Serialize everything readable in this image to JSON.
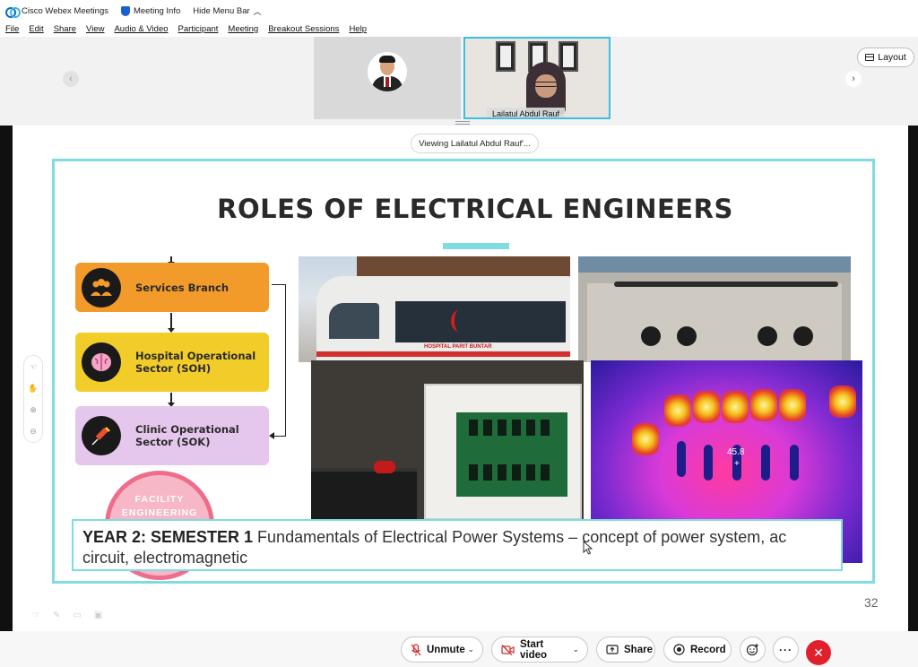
{
  "titlebar": {
    "app_name": "Cisco Webex Meetings",
    "meeting_info": "Meeting Info",
    "hide_menu": "Hide Menu Bar"
  },
  "menu": [
    "File",
    "Edit",
    "Share",
    "View",
    "Audio & Video",
    "Participant",
    "Meeting",
    "Breakout Sessions",
    "Help"
  ],
  "participants": {
    "tile2_name": "Lailatul Abdul Rauf",
    "layout_label": "Layout"
  },
  "viewing": "Viewing Lailatul Abdul Rauf'...",
  "slide": {
    "title": "ROLES OF ELECTRICAL ENGINEERS",
    "boxes": [
      {
        "label_line1": "Services Branch",
        "label_line2": ""
      },
      {
        "label_line1": "Hospital Operational",
        "label_line2": "Sector (SOH)"
      },
      {
        "label_line1": "Clinic Operational",
        "label_line2": "Sector (SOK)"
      }
    ],
    "facility_line1": "FACILITY",
    "facility_line2": "ENGINEERING",
    "ambulance_text": "HOSPITAL PARIT BUNTAR",
    "thermal_reading": "45.8",
    "caption_bold": "YEAR 2: SEMESTER 1",
    "caption_text": " Fundamentals of Electrical Power Systems – concept of power system, ac circuit, electromagnetic",
    "page_number": "32"
  },
  "controls": {
    "unmute": "Unmute",
    "start_video": "Start video",
    "share": "Share",
    "record": "Record"
  },
  "colors": {
    "accent_teal": "#7fdce3",
    "services_orange": "#f29b2a",
    "hospital_yellow": "#f2cd2a",
    "clinic_lilac": "#e5c7ee",
    "end_red": "#e0202b"
  }
}
